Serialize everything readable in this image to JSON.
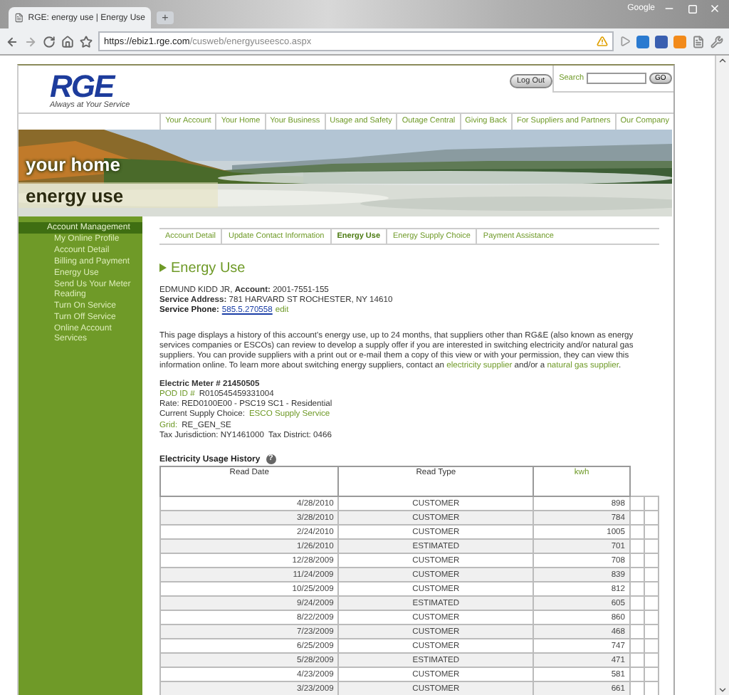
{
  "browser": {
    "tab_title": "RGE: energy use | Energy Use",
    "new_tab": "+",
    "corner_label": "Google",
    "url_host": "https://ebiz1.rge.com",
    "url_path": "/cusweb/energyuseesco.aspx"
  },
  "header": {
    "logo": "RGE",
    "tagline": "Always at Your Service",
    "logout": "Log Out",
    "search_label": "Search",
    "search_button": "GO"
  },
  "nav": [
    "Your Account",
    "Your Home",
    "Your Business",
    "Usage and Safety",
    "Outage Central",
    "Giving Back",
    "For Suppliers and Partners",
    "Our Company"
  ],
  "banner": {
    "title": "your home",
    "subtitle": "energy use"
  },
  "sidebar": {
    "heading": "Account Management",
    "items": [
      "My Online Profile",
      "Account Detail",
      "Billing and Payment",
      "Energy Use",
      "Send Us Your Meter Reading",
      "Turn On Service",
      "Turn Off Service",
      "Online Account Services"
    ]
  },
  "subtabs": [
    {
      "label": "Account Detail",
      "selected": false
    },
    {
      "label": "Update Contact Information",
      "selected": false
    },
    {
      "label": "Energy Use",
      "selected": true
    },
    {
      "label": "Energy Supply Choice",
      "selected": false
    },
    {
      "label": "Payment Assistance",
      "selected": false
    }
  ],
  "section_title": "Energy Use",
  "account_lines": [
    "EDMUND KIDD JR, **Account:** 2001-7551-155",
    "**Service Address:** 781 HARVARD ST ROCHESTER, NY 14610"
  ],
  "service_phone": {
    "label": "Service Phone:",
    "number": "585.5.270558",
    "edit": "edit"
  },
  "paragraph": [
    {
      "text": "This page displays a history of this account's energy use, up to 24 months, that suppliers other than RG&E (also known as energy services companies or ESCOs) can review to develop a supply offer if you are interested in switching electricity and/or natural gas suppliers. You can provide suppliers with a print out or e-mail them a copy of this view or with your permission, they can view this information online. To learn more about switching energy suppliers, contact an ",
      "kind": "text"
    },
    {
      "text": "electricity supplier",
      "kind": "link"
    },
    {
      "text": " and/or a ",
      "kind": "text"
    },
    {
      "text": "natural gas supplier",
      "kind": "link"
    },
    {
      "text": ".",
      "kind": "text"
    }
  ],
  "meter_lines": [
    [
      {
        "text": "Electric Meter # 21450505",
        "kind": "heading"
      }
    ],
    [
      {
        "text": "POD ID #",
        "kind": "link"
      },
      {
        "text": "R010545459331004",
        "kind": "text"
      }
    ],
    [
      {
        "text": "Rate: RED0100E00 - PSC19 SC1 - Residential",
        "kind": "text"
      }
    ],
    [
      {
        "text": "Current Supply Choice:",
        "kind": "text"
      },
      {
        "text": "ESCO Supply Service",
        "kind": "link"
      }
    ],
    [
      {
        "text": "Grid:",
        "kind": "link"
      },
      {
        "text": "RE_GEN_SE",
        "kind": "text"
      }
    ],
    [
      {
        "text": "Tax Jurisdiction: NY1461000",
        "kind": "text"
      },
      {
        "text": "Tax District: 0466",
        "kind": "text"
      }
    ]
  ],
  "usage": {
    "title": "Electricity Usage History",
    "help": "?",
    "columns": [
      "Read Date",
      "Read Type",
      "kwh"
    ],
    "rows": [
      [
        "4/28/2010",
        "CUSTOMER",
        "898"
      ],
      [
        "3/28/2010",
        "CUSTOMER",
        "784"
      ],
      [
        "2/24/2010",
        "CUSTOMER",
        "1005"
      ],
      [
        "1/26/2010",
        "ESTIMATED",
        "701"
      ],
      [
        "12/28/2009",
        "CUSTOMER",
        "708"
      ],
      [
        "11/24/2009",
        "CUSTOMER",
        "839"
      ],
      [
        "10/25/2009",
        "CUSTOMER",
        "812"
      ],
      [
        "9/24/2009",
        "ESTIMATED",
        "605"
      ],
      [
        "8/22/2009",
        "CUSTOMER",
        "860"
      ],
      [
        "7/23/2009",
        "CUSTOMER",
        "468"
      ],
      [
        "6/25/2009",
        "CUSTOMER",
        "747"
      ],
      [
        "5/28/2009",
        "ESTIMATED",
        "471"
      ],
      [
        "4/23/2009",
        "CUSTOMER",
        "581"
      ],
      [
        "3/23/2009",
        "CUSTOMER",
        "661"
      ]
    ]
  }
}
